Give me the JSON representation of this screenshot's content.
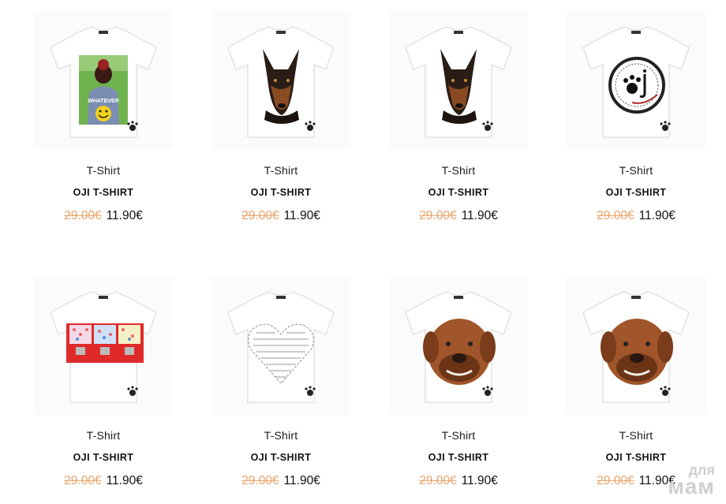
{
  "products": [
    {
      "category": "T-Shirt",
      "name": "OJI T-SHIRT",
      "old_price": "29.00€",
      "new_price": "11.90€",
      "print": "whatever-girl"
    },
    {
      "category": "T-Shirt",
      "name": "OJI T-SHIRT",
      "old_price": "29.00€",
      "new_price": "11.90€",
      "print": "doberman"
    },
    {
      "category": "T-Shirt",
      "name": "OJI T-SHIRT",
      "old_price": "29.00€",
      "new_price": "11.90€",
      "print": "doberman"
    },
    {
      "category": "T-Shirt",
      "name": "OJI T-SHIRT",
      "old_price": "29.00€",
      "new_price": "11.90€",
      "print": "oji-stamp"
    },
    {
      "category": "T-Shirt",
      "name": "OJI T-SHIRT",
      "old_price": "29.00€",
      "new_price": "11.90€",
      "print": "gumball-machines"
    },
    {
      "category": "T-Shirt",
      "name": "OJI T-SHIRT",
      "old_price": "29.00€",
      "new_price": "11.90€",
      "print": "word-heart"
    },
    {
      "category": "T-Shirt",
      "name": "OJI T-SHIRT",
      "old_price": "29.00€",
      "new_price": "11.90€",
      "print": "mastiff"
    },
    {
      "category": "T-Shirt",
      "name": "OJI T-SHIRT",
      "old_price": "29.00€",
      "new_price": "11.90€",
      "print": "mastiff"
    }
  ],
  "print_lettering": {
    "whatever": "WHATEVER"
  },
  "watermark": {
    "line1": "для",
    "line2": "мам"
  },
  "colors": {
    "old_price": "#e8a46b",
    "text": "#111111"
  }
}
